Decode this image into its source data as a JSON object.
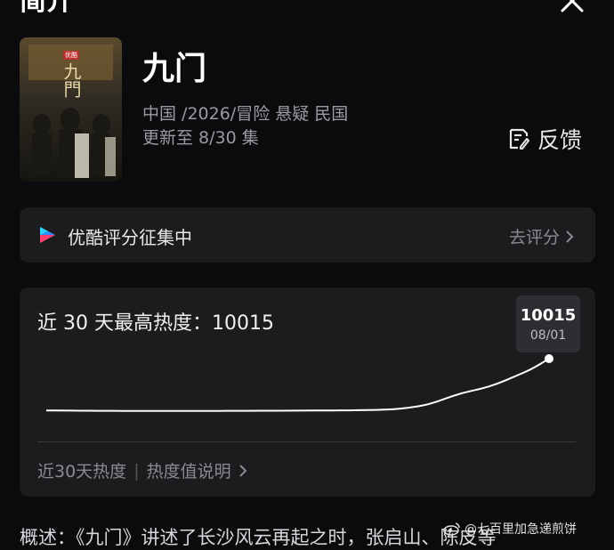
{
  "header": {
    "title": "简介"
  },
  "show": {
    "title": "九门",
    "meta": "中国 /2026/冒险 悬疑 民国",
    "episodes": "更新至 8/30 集",
    "poster_title": "九門",
    "poster_badge": "优酷"
  },
  "feedback": {
    "label": "反馈",
    "icon": "feedback-icon"
  },
  "rating": {
    "title": "优酷评分征集中",
    "action": "去评分",
    "icon": "youku-logo"
  },
  "heat": {
    "title": "近 30 天最高热度：10015",
    "footer_left": "近30天热度",
    "footer_right": "热度值说明",
    "peak_value": "10015",
    "peak_date": "08/01"
  },
  "chart_data": {
    "type": "line",
    "series": [
      {
        "values": [
          6510,
          6500,
          6490,
          6485,
          6480,
          6475,
          6470,
          6470,
          6472,
          6475,
          6480,
          6485,
          6488,
          6490,
          6495,
          6500,
          6505,
          6510,
          6520,
          6540,
          6580,
          6700,
          6900,
          7300,
          7700,
          7950,
          8300,
          8800,
          9300,
          10015
        ]
      }
    ],
    "peak": {
      "value": 10015,
      "date": "08/01"
    }
  },
  "summary": {
    "text": "概述：《九门》讲述了长沙风云再起之时，张启山、陈皮等"
  },
  "watermark": {
    "text": "@七百里加急递煎饼"
  },
  "colors": {
    "background": "#0b0b0d",
    "card": "#1c1c1f",
    "youku_blue": "#2b8cff",
    "youku_pink": "#ff3d6e"
  }
}
